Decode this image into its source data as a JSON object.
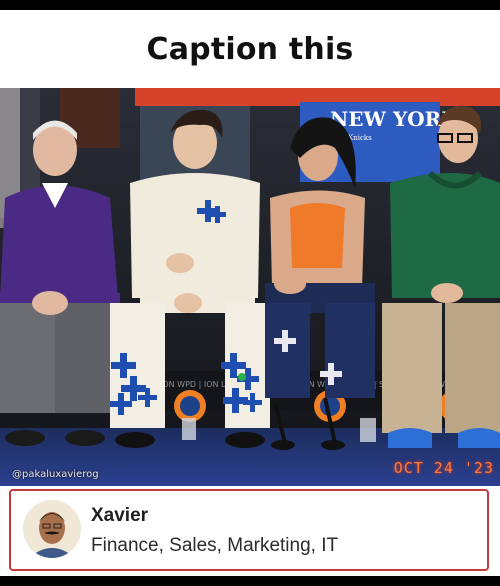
{
  "post": {
    "heading": "Caption this"
  },
  "photo": {
    "watermark": "@pakaluxavierog",
    "date_stamp": "OCT 24 '23",
    "jersey_text": "NEW YORK",
    "jersey_subtext": "Knicks",
    "board_text": "ION WPD | ION LA | S"
  },
  "profile": {
    "name": "Xavier",
    "tags": "Finance, Sales, Marketing, IT",
    "border_color": "#c43a3a"
  },
  "icons": {
    "avatar": "person-avatar"
  }
}
